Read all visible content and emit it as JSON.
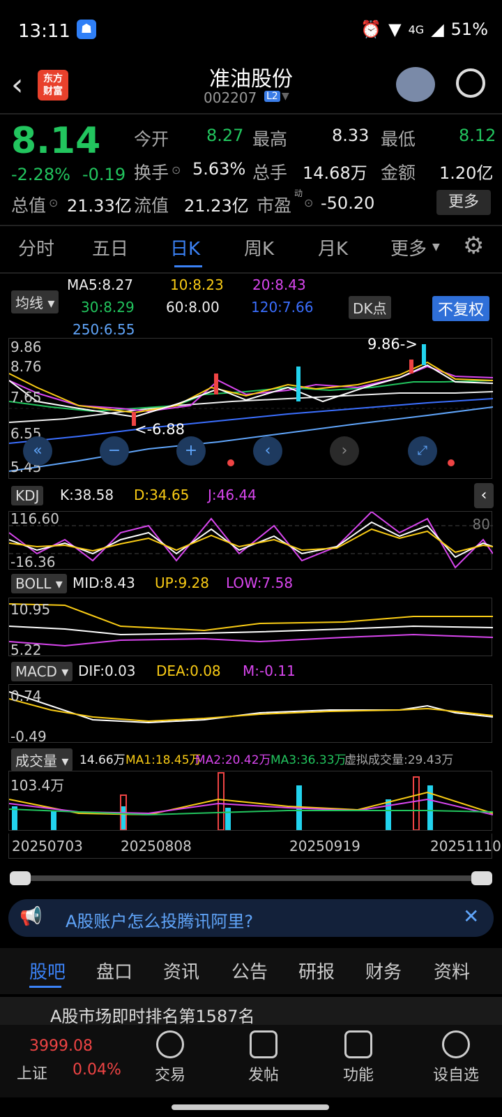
{
  "status": {
    "time": "13:11",
    "network": "4G",
    "battery": "51%"
  },
  "header": {
    "name": "准油股份",
    "code": "002207",
    "badge": "L2",
    "logo": "东方\n财富"
  },
  "quote": {
    "price": "8.14",
    "pct": "-2.28%",
    "chg": "-0.19",
    "open_label": "今开",
    "open": "8.27",
    "high_label": "最高",
    "high": "8.33",
    "low_label": "最低",
    "low": "8.12",
    "turnover_label": "换手",
    "turnover": "5.63%",
    "volume_label": "总手",
    "volume": "14.68万",
    "amount_label": "金额",
    "amount": "1.20亿",
    "mktcap_label": "总值",
    "mktcap": "21.33亿",
    "float_label": "流值",
    "float": "21.23亿",
    "pe_label": "市盈",
    "pe_sup": "动",
    "pe": "-50.20",
    "more": "更多"
  },
  "tabs": [
    "分时",
    "五日",
    "日K",
    "周K",
    "月K",
    "更多"
  ],
  "ma": {
    "label": "均线",
    "ma5": "MA5:8.27",
    "ma10": "10:8.23",
    "ma20": "20:8.43",
    "ma30": "30:8.29",
    "ma60": "60:8.00",
    "ma120": "120:7.66",
    "ma250": "250:6.55",
    "dk": "DK点",
    "fq": "不复权"
  },
  "kline": {
    "y_top": "9.86",
    "y2": "8.76",
    "y3": "7.65",
    "y4": "6.55",
    "y5": "5.45",
    "high_marker": "9.86->",
    "low_marker": "<-6.88"
  },
  "kdj": {
    "label": "KDJ",
    "k": "K:38.58",
    "d": "D:34.65",
    "j": "J:46.44",
    "y_top": "116.60",
    "y_bottom": "-16.36",
    "right": "80"
  },
  "boll": {
    "label": "BOLL",
    "mid": "MID:8.43",
    "up": "UP:9.28",
    "low": "LOW:7.58",
    "y_top": "10.95",
    "y_bottom": "5.22"
  },
  "macd": {
    "label": "MACD",
    "dif": "DIF:0.03",
    "dea": "DEA:0.08",
    "m": "M:-0.11",
    "y_top": "0.74",
    "y_bottom": "-0.49"
  },
  "vol": {
    "label": "成交量",
    "v": "14.66万",
    "ma1": "MA1:18.45万",
    "ma2": "MA2:20.42万",
    "ma3": "MA3:36.33万",
    "virtual": "虚拟成交量:29.43万",
    "y_top": "103.4万"
  },
  "dates": [
    "20250703",
    "20250808",
    "20250919",
    "20251110"
  ],
  "ad": {
    "text": "A股账户怎么投腾讯阿里?"
  },
  "bottom_tabs": [
    "股吧",
    "盘口",
    "资讯",
    "公告",
    "研报",
    "财务",
    "资料"
  ],
  "teaser": "A股市场即时排名第1587名",
  "index": {
    "name": "上证",
    "value": "3999.08",
    "pct": "0.04%"
  },
  "nav": [
    "交易",
    "发帖",
    "功能",
    "设自选"
  ],
  "colors": {
    "up": "#ef4444",
    "down": "#22c55e",
    "accent": "#3b82f6"
  }
}
